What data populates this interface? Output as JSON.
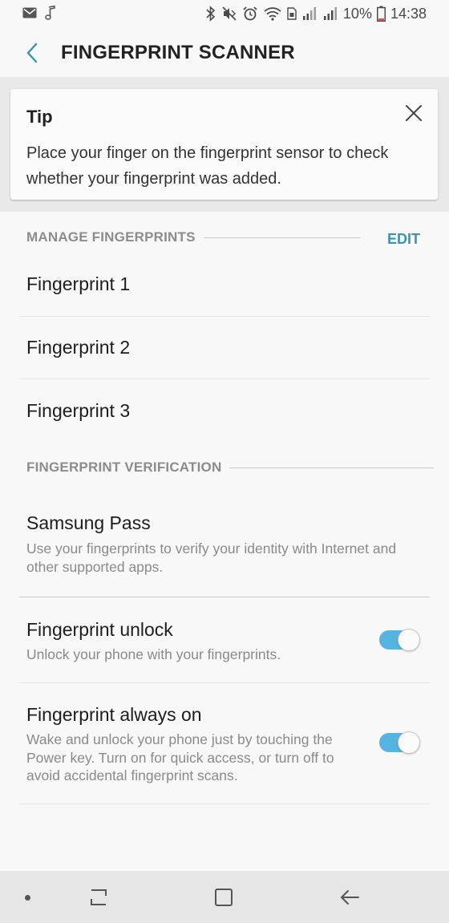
{
  "status_bar": {
    "battery_percent": "10%",
    "time": "14:38",
    "left_icons": [
      "mail-icon",
      "music-note-icon"
    ],
    "right_icons": [
      "bluetooth-icon",
      "mute-icon",
      "alarm-icon",
      "wifi-icon",
      "signal-icon",
      "signal-icon",
      "battery-icon"
    ]
  },
  "app_bar": {
    "back_icon": "chevron-left-icon",
    "title": "FINGERPRINT SCANNER"
  },
  "tip": {
    "title": "Tip",
    "text": "Place your finger on the fingerprint sensor to check whether your fingerprint was added.",
    "close_icon": "close-icon"
  },
  "manage": {
    "header": "MANAGE FINGERPRINTS",
    "edit_label": "EDIT",
    "items": [
      {
        "label": "Fingerprint 1"
      },
      {
        "label": "Fingerprint 2"
      },
      {
        "label": "Fingerprint 3"
      }
    ]
  },
  "verification": {
    "header": "FINGERPRINT VERIFICATION",
    "items": [
      {
        "title": "Samsung Pass",
        "subtitle": "Use your fingerprints to verify your identity with Internet and other supported apps."
      },
      {
        "title": "Fingerprint unlock",
        "subtitle": "Unlock your phone with your fingerprints.",
        "toggle_on": true
      },
      {
        "title": "Fingerprint always on",
        "subtitle": "Wake and unlock your phone just by touching the Power key. Turn on for quick access, or turn off to avoid accidental fingerprint scans.",
        "toggle_on": true
      }
    ]
  },
  "nav_bar": {
    "icons": [
      "recents-icon",
      "home-icon",
      "back-icon"
    ]
  },
  "colors": {
    "accent": "#3c94ab",
    "toggle_on": "#56b4e0",
    "background": "#f8f8f8"
  }
}
